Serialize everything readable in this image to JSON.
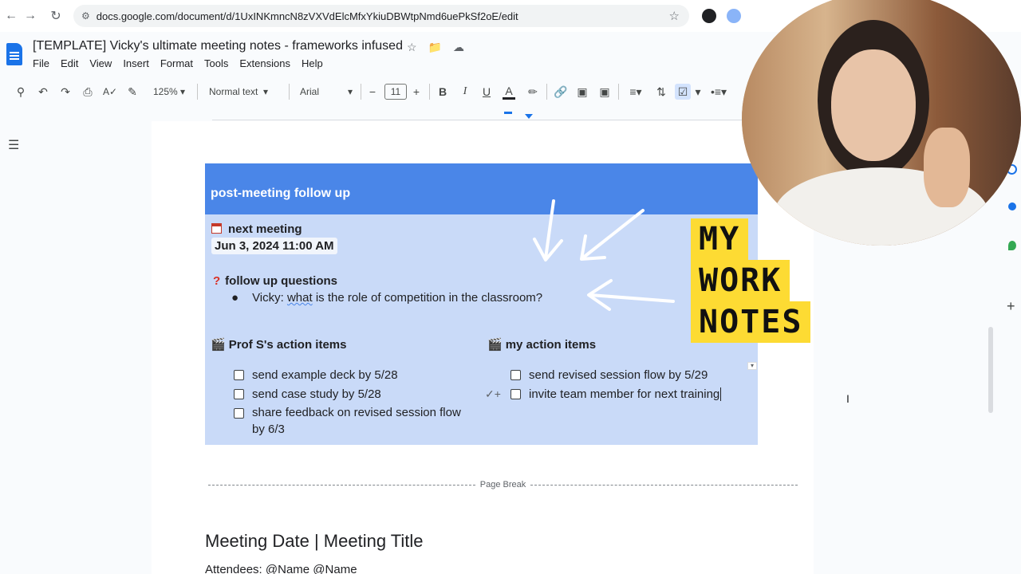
{
  "browser": {
    "url": "docs.google.com/document/d/1UxINKmncN8zVXVdElcMfxYkiuDBWtpNmd6uePkSf2oE/edit"
  },
  "doc": {
    "title": "[TEMPLATE] Vicky's ultimate meeting notes - frameworks infused",
    "menu": [
      "File",
      "Edit",
      "View",
      "Insert",
      "Format",
      "Tools",
      "Extensions",
      "Help"
    ]
  },
  "toolbar": {
    "zoom": "125%",
    "style": "Normal text",
    "font": "Arial",
    "font_size": "11"
  },
  "content": {
    "banner_title": "post-meeting follow up",
    "next_meeting_label": "next meeting",
    "next_meeting_date": "Jun 3, 2024 11:00 AM",
    "follow_up_label": "follow up questions",
    "follow_up_prefix": "Vicky: ",
    "follow_up_squiggle": "what",
    "follow_up_rest": " is the role of competition in the classroom?",
    "prof_label": "Prof S's action items",
    "prof_items": [
      "send example deck by 5/28",
      "send case study by 5/28",
      "share feedback on revised session flow",
      "by 6/3"
    ],
    "my_label": "my action items",
    "my_items": [
      "send revised session flow by 5/29",
      "invite team member for next training"
    ],
    "page_break": "Page Break",
    "meeting_heading": "Meeting Date | Meeting Title",
    "attendees": "Attendees: @Name @Name"
  },
  "overlay": {
    "lines": [
      "MY",
      "WORK",
      "NOTES"
    ]
  },
  "colors": {
    "banner": "#4a86e8",
    "panel": "#c9daf8",
    "sticker": "#fddb33",
    "accent": "#1a73e8"
  }
}
